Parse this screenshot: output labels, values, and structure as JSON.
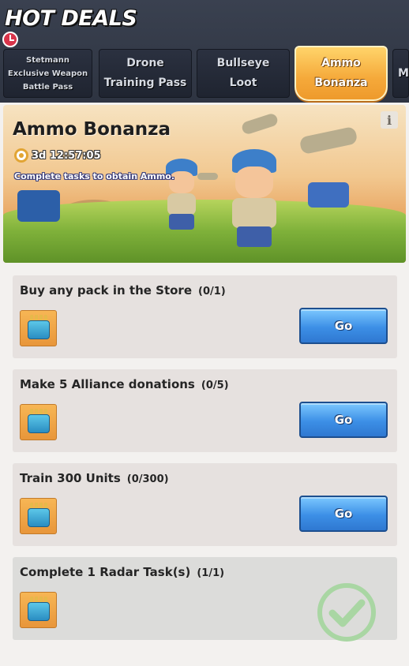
{
  "header": {
    "title": "HOT DEALS"
  },
  "tabs": [
    {
      "label": "Stetmann\nExclusive Weapon\nBattle Pass",
      "active": false
    },
    {
      "label": "Drone\nTraining Pass",
      "active": false
    },
    {
      "label": "Bullseye\nLoot",
      "active": false
    },
    {
      "label": "Ammo\nBonanza",
      "active": true
    },
    {
      "label": "M",
      "active": false
    }
  ],
  "banner": {
    "title": "Ammo Bonanza",
    "timer": "3d 12:57:05",
    "description": "Complete tasks to obtain Ammo.",
    "info_icon": "i"
  },
  "tasks": [
    {
      "text": "Buy any pack in the Store",
      "progress": "(0/1)",
      "button": "Go",
      "completed": false
    },
    {
      "text": "Make 5 Alliance donations",
      "progress": "(0/5)",
      "button": "Go",
      "completed": false
    },
    {
      "text": "Train 300 Units",
      "progress": "(0/300)",
      "button": "Go",
      "completed": false
    },
    {
      "text": "Complete 1 Radar Task(s)",
      "progress": "(1/1)",
      "completed": true
    }
  ],
  "colors": {
    "go_button": "#3c8fe6",
    "active_tab": "#f5a93a",
    "check": "#9fd49a"
  }
}
